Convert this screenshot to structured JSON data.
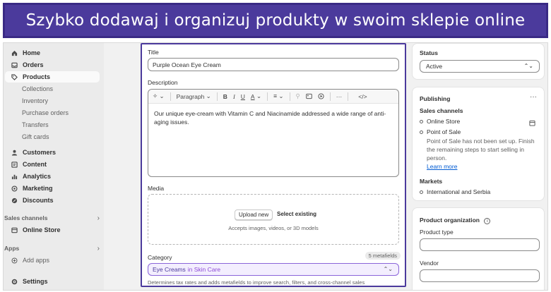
{
  "banner": {
    "text": "Szybko dodawaj i organizuj produkty w swoim sklepie online"
  },
  "sidebar": {
    "items": [
      {
        "label": "Home",
        "icon": "home-icon"
      },
      {
        "label": "Orders",
        "icon": "inbox-icon"
      },
      {
        "label": "Products",
        "icon": "tag-icon"
      },
      {
        "label": "Collections"
      },
      {
        "label": "Inventory"
      },
      {
        "label": "Purchase orders"
      },
      {
        "label": "Transfers"
      },
      {
        "label": "Gift cards"
      },
      {
        "label": "Customers",
        "icon": "person-icon"
      },
      {
        "label": "Content",
        "icon": "content-icon"
      },
      {
        "label": "Analytics",
        "icon": "bar-chart-icon"
      },
      {
        "label": "Marketing",
        "icon": "target-icon"
      },
      {
        "label": "Discounts",
        "icon": "discount-icon"
      }
    ],
    "sales_channels_label": "Sales channels",
    "online_store_label": "Online Store",
    "apps_label": "Apps",
    "add_apps_label": "Add apps",
    "settings_label": "Settings"
  },
  "main": {
    "title_label": "Title",
    "title_value": "Purple Ocean Eye Cream",
    "description_label": "Description",
    "toolbar": {
      "paragraph": "Paragraph"
    },
    "description_text": "Our unique eye-cream with Vitamin C and Niacinamide addressed a wide range of anti-aging issues.",
    "media_label": "Media",
    "upload_new": "Upload new",
    "select_existing": "Select existing",
    "media_hint": "Accepts images, videos, or 3D models",
    "category_label": "Category",
    "metafields": "5 metafields",
    "category_value": "Eye Creams",
    "category_in": "in Skin Care",
    "category_hint": "Determines tax rates and adds metafields to improve search, filters, and cross-channel sales"
  },
  "status_card": {
    "title": "Status",
    "value": "Active"
  },
  "publishing_card": {
    "title": "Publishing",
    "sales_channels": "Sales channels",
    "online_store": "Online Store",
    "point_of_sale": "Point of Sale",
    "pos_note": "Point of Sale has not been set up. Finish the remaining steps to start selling in person.",
    "learn_more": "Learn more",
    "markets": "Markets",
    "markets_value": "International and Serbia"
  },
  "org_card": {
    "title": "Product organization",
    "product_type": "Product type",
    "vendor": "Vendor"
  },
  "colors": {
    "accent": "#4b3a9c",
    "category_bg": "#f3eefe",
    "link": "#005bd3"
  }
}
